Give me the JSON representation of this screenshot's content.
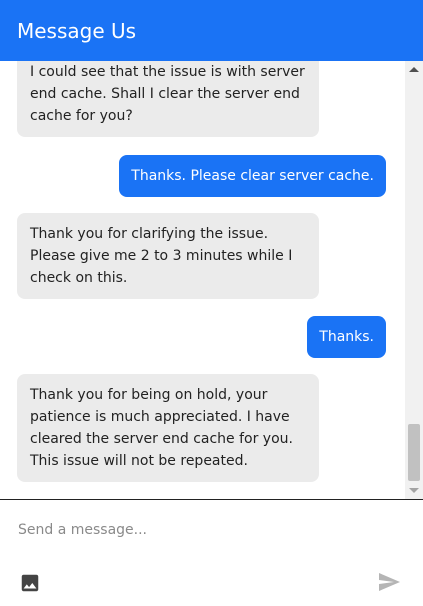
{
  "header": {
    "title": "Message Us"
  },
  "messages": [
    {
      "sender": "bot",
      "text": "I could see that the issue is with server end cache. Shall I clear the server end cache for you?"
    },
    {
      "sender": "user",
      "text": "Thanks. Please clear server cache."
    },
    {
      "sender": "bot",
      "text": "Thank you for clarifying the issue. Please give me 2 to 3 minutes while I check on this."
    },
    {
      "sender": "user",
      "text": "Thanks."
    },
    {
      "sender": "bot",
      "text": "Thank you for being on hold, your patience is much appreciated. I have cleared the server end cache for you. This issue will not be repeated."
    }
  ],
  "composer": {
    "placeholder": "Send a message...",
    "attach_icon": "image-icon",
    "send_icon": "send-icon"
  },
  "colors": {
    "accent": "#1a73f5",
    "bot_bubble": "#ebebeb",
    "bot_text": "#222222",
    "user_text": "#ffffff"
  }
}
